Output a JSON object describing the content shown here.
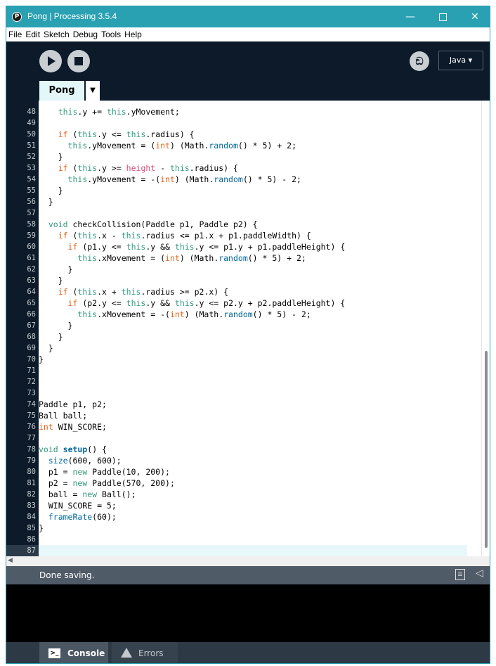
{
  "window": {
    "title": "Pong | Processing 3.5.4",
    "app_icon": "processing-logo-icon",
    "controls": {
      "minimize": "—",
      "close": "✕"
    }
  },
  "menu": [
    "File",
    "Edit",
    "Sketch",
    "Debug",
    "Tools",
    "Help"
  ],
  "toolbar": {
    "run_icon": "play-icon",
    "stop_icon": "stop-icon",
    "debug_icon": "butterfly-debug-icon",
    "debug_glyph": "ඞ",
    "mode": "Java ▾"
  },
  "tabs": {
    "active": "Pong",
    "menu_arrow": "▼"
  },
  "editor": {
    "first_line": 48,
    "current_line": 87,
    "lines": [
      [
        [
          " ",
          "    "
        ],
        [
          "kw1",
          "this"
        ],
        [
          "",
          ".y += "
        ],
        [
          "kw1",
          "this"
        ],
        [
          "",
          ".yMovement;"
        ]
      ],
      [],
      [
        [
          " ",
          "    "
        ],
        [
          "kw2",
          "if"
        ],
        [
          "",
          " ("
        ],
        [
          "kw1",
          "this"
        ],
        [
          "",
          ".y <= "
        ],
        [
          "kw1",
          "this"
        ],
        [
          "",
          ".radius) {"
        ]
      ],
      [
        [
          " ",
          "      "
        ],
        [
          "kw1",
          "this"
        ],
        [
          "",
          ".yMovement = ("
        ],
        [
          "kw2",
          "int"
        ],
        [
          "",
          ") (Math."
        ],
        [
          "fn",
          "random"
        ],
        [
          "",
          "() * 5) + 2;"
        ]
      ],
      [
        [
          " ",
          "    }"
        ]
      ],
      [
        [
          " ",
          "    "
        ],
        [
          "kw2",
          "if"
        ],
        [
          "",
          " ("
        ],
        [
          "kw1",
          "this"
        ],
        [
          "",
          ".y >= "
        ],
        [
          "var",
          "height"
        ],
        [
          "",
          " - "
        ],
        [
          "kw1",
          "this"
        ],
        [
          "",
          ".radius) {"
        ]
      ],
      [
        [
          " ",
          "      "
        ],
        [
          "kw1",
          "this"
        ],
        [
          "",
          ".yMovement = -("
        ],
        [
          "kw2",
          "int"
        ],
        [
          "",
          ") (Math."
        ],
        [
          "fn",
          "random"
        ],
        [
          "",
          "() * 5) - 2;"
        ]
      ],
      [
        [
          " ",
          "    }"
        ]
      ],
      [
        [
          " ",
          "  }"
        ]
      ],
      [],
      [
        [
          " ",
          "  "
        ],
        [
          "kw1",
          "void"
        ],
        [
          "",
          " checkCollision(Paddle p1, Paddle p2) {"
        ]
      ],
      [
        [
          " ",
          "    "
        ],
        [
          "kw2",
          "if"
        ],
        [
          "",
          " ("
        ],
        [
          "kw1",
          "this"
        ],
        [
          "",
          ".x - "
        ],
        [
          "kw1",
          "this"
        ],
        [
          "",
          ".radius <= p1.x + p1.paddleWidth) {"
        ]
      ],
      [
        [
          " ",
          "      "
        ],
        [
          "kw2",
          "if"
        ],
        [
          "",
          " (p1.y <= "
        ],
        [
          "kw1",
          "this"
        ],
        [
          "",
          ".y && "
        ],
        [
          "kw1",
          "this"
        ],
        [
          "",
          ".y <= p1.y + p1.paddleHeight) {"
        ]
      ],
      [
        [
          " ",
          "        "
        ],
        [
          "kw1",
          "this"
        ],
        [
          "",
          ".xMovement = ("
        ],
        [
          "kw2",
          "int"
        ],
        [
          "",
          ") (Math."
        ],
        [
          "fn",
          "random"
        ],
        [
          "",
          "() * 5) + 2;"
        ]
      ],
      [
        [
          " ",
          "      }"
        ]
      ],
      [
        [
          " ",
          "    }"
        ]
      ],
      [
        [
          " ",
          "    "
        ],
        [
          "kw2",
          "if"
        ],
        [
          "",
          " ("
        ],
        [
          "kw1",
          "this"
        ],
        [
          "",
          ".x + "
        ],
        [
          "kw1",
          "this"
        ],
        [
          "",
          ".radius >= p2.x) {"
        ]
      ],
      [
        [
          " ",
          "      "
        ],
        [
          "kw2",
          "if"
        ],
        [
          "",
          " (p2.y <= "
        ],
        [
          "kw1",
          "this"
        ],
        [
          "",
          ".y && "
        ],
        [
          "kw1",
          "this"
        ],
        [
          "",
          ".y <= p2.y + p2.paddleHeight) {"
        ]
      ],
      [
        [
          " ",
          "        "
        ],
        [
          "kw1",
          "this"
        ],
        [
          "",
          ".xMovement = -("
        ],
        [
          "kw2",
          "int"
        ],
        [
          "",
          ") (Math."
        ],
        [
          "fn",
          "random"
        ],
        [
          "",
          "() * 5) - 2;"
        ]
      ],
      [
        [
          " ",
          "      }"
        ]
      ],
      [
        [
          " ",
          "    }"
        ]
      ],
      [
        [
          " ",
          "  }"
        ]
      ],
      [
        [
          " ",
          "}"
        ]
      ],
      [],
      [],
      [],
      [
        [
          " ",
          "Paddle p1, p2;"
        ]
      ],
      [
        [
          " ",
          "Ball ball;"
        ]
      ],
      [
        [
          "kw2",
          "int"
        ],
        [
          "",
          " WIN_SCORE;"
        ]
      ],
      [],
      [
        [
          "kw1",
          "void"
        ],
        [
          "",
          " "
        ],
        [
          "fnb",
          "setup"
        ],
        [
          "",
          "() {"
        ]
      ],
      [
        [
          " ",
          "  "
        ],
        [
          "fn",
          "size"
        ],
        [
          "",
          "(600, 600);"
        ]
      ],
      [
        [
          " ",
          "  p1 = "
        ],
        [
          "kw1",
          "new"
        ],
        [
          "",
          " Paddle(10, 200);"
        ]
      ],
      [
        [
          " ",
          "  p2 = "
        ],
        [
          "kw1",
          "new"
        ],
        [
          "",
          " Paddle(570, 200);"
        ]
      ],
      [
        [
          " ",
          "  ball = "
        ],
        [
          "kw1",
          "new"
        ],
        [
          "",
          " Ball();"
        ]
      ],
      [
        [
          " ",
          "  WIN_SCORE = 5;"
        ]
      ],
      [
        [
          " ",
          "  "
        ],
        [
          "fn",
          "frameRate"
        ],
        [
          "",
          "(60);"
        ]
      ],
      [
        [
          " ",
          "}"
        ]
      ],
      [],
      []
    ]
  },
  "status": {
    "message": "Done saving.",
    "clipboard_icon": "clipboard-icon",
    "collapse_icon": "collapse-arrow-icon",
    "collapse_glyph": "◁"
  },
  "bottom_tabs": {
    "console": "Console",
    "console_glyph": ">_",
    "errors": "Errors",
    "errors_icon": "warning-icon"
  }
}
